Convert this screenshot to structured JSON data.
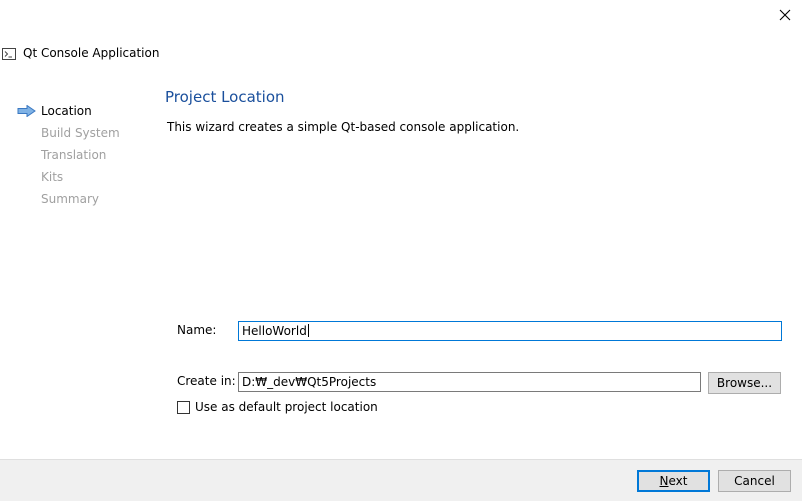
{
  "window": {
    "title": "Qt Console Application",
    "title_icon": "console-icon",
    "close_icon": "close-icon"
  },
  "steps": [
    {
      "label": "Location",
      "active": true
    },
    {
      "label": "Build System",
      "active": false
    },
    {
      "label": "Translation",
      "active": false
    },
    {
      "label": "Kits",
      "active": false
    },
    {
      "label": "Summary",
      "active": false
    }
  ],
  "page": {
    "title": "Project Location",
    "description": "This wizard creates a simple Qt-based console application."
  },
  "form": {
    "name_label": "Name:",
    "name_value": "HelloWorld",
    "create_in_label": "Create in:",
    "create_in_value": "D:₩_dev₩Qt5Projects",
    "browse_label": "Browse...",
    "default_location_label": "Use as default project location",
    "default_location_checked": false
  },
  "footer": {
    "next_label": "Next",
    "cancel_label": "Cancel"
  },
  "colors": {
    "title_blue": "#1a4f9c",
    "focus_blue": "#0078d7",
    "disabled_text": "#a0a0a0"
  }
}
